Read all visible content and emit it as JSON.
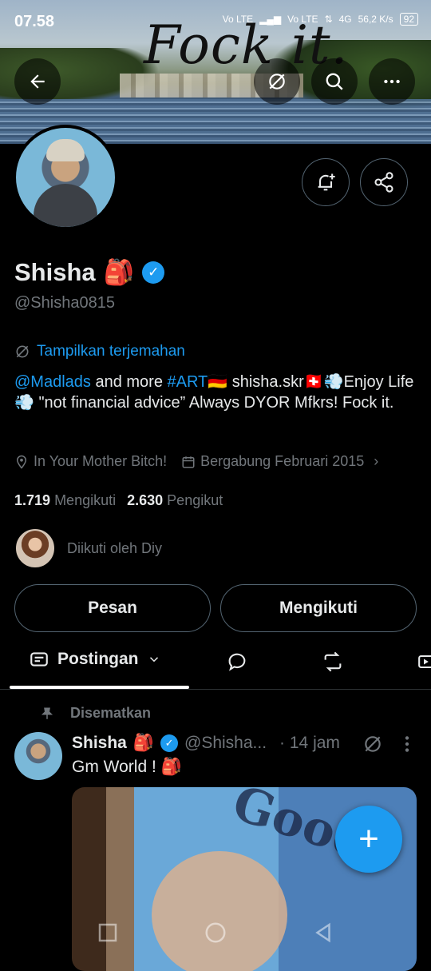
{
  "status_bar": {
    "time": "07.58",
    "network1": "Vo LTE",
    "network2": "Vo LTE",
    "data_type": "4G",
    "speed": "56,2 K/s",
    "battery": "92"
  },
  "banner": {
    "text": "Fock it."
  },
  "top_actions": {
    "back_icon": "arrow-left-icon",
    "translate_icon": "translate-off-icon",
    "search_icon": "search-icon",
    "more_icon": "more-horizontal-icon"
  },
  "profile": {
    "name": "Shisha",
    "name_emoji": "🎒",
    "handle": "@Shisha0815",
    "translate_label": "Tampilkan terjemahan",
    "bio": {
      "mention": "@Madlads",
      "part1": " and more ",
      "hashtag": "#ART",
      "part2": "🇩🇪 shisha.skr🇨🇭💨Enjoy Life💨 \"not financial advice” Always DYOR Mfkrs! Fock it."
    },
    "location": "In Your Mother Bitch!",
    "joined": "Bergabung Februari 2015",
    "following_count": "1.719",
    "following_label": "Mengikuti",
    "followers_count": "2.630",
    "followers_label": "Pengikut",
    "followed_by": "Diikuti oleh Diy"
  },
  "buttons": {
    "message": "Pesan",
    "following": "Mengikuti"
  },
  "tabs": {
    "active": "Postingan"
  },
  "post": {
    "pinned_label": "Disematkan",
    "author": "Shisha",
    "author_emoji": "🎒",
    "handle": "@Shisha...",
    "time": "· 14 jam",
    "text": "Gm World ! 🎒"
  },
  "fab": {
    "label": "+"
  },
  "colors": {
    "accent": "#1d9bf0",
    "background": "#000000",
    "muted": "#71767b",
    "text": "#e7e9ea"
  }
}
